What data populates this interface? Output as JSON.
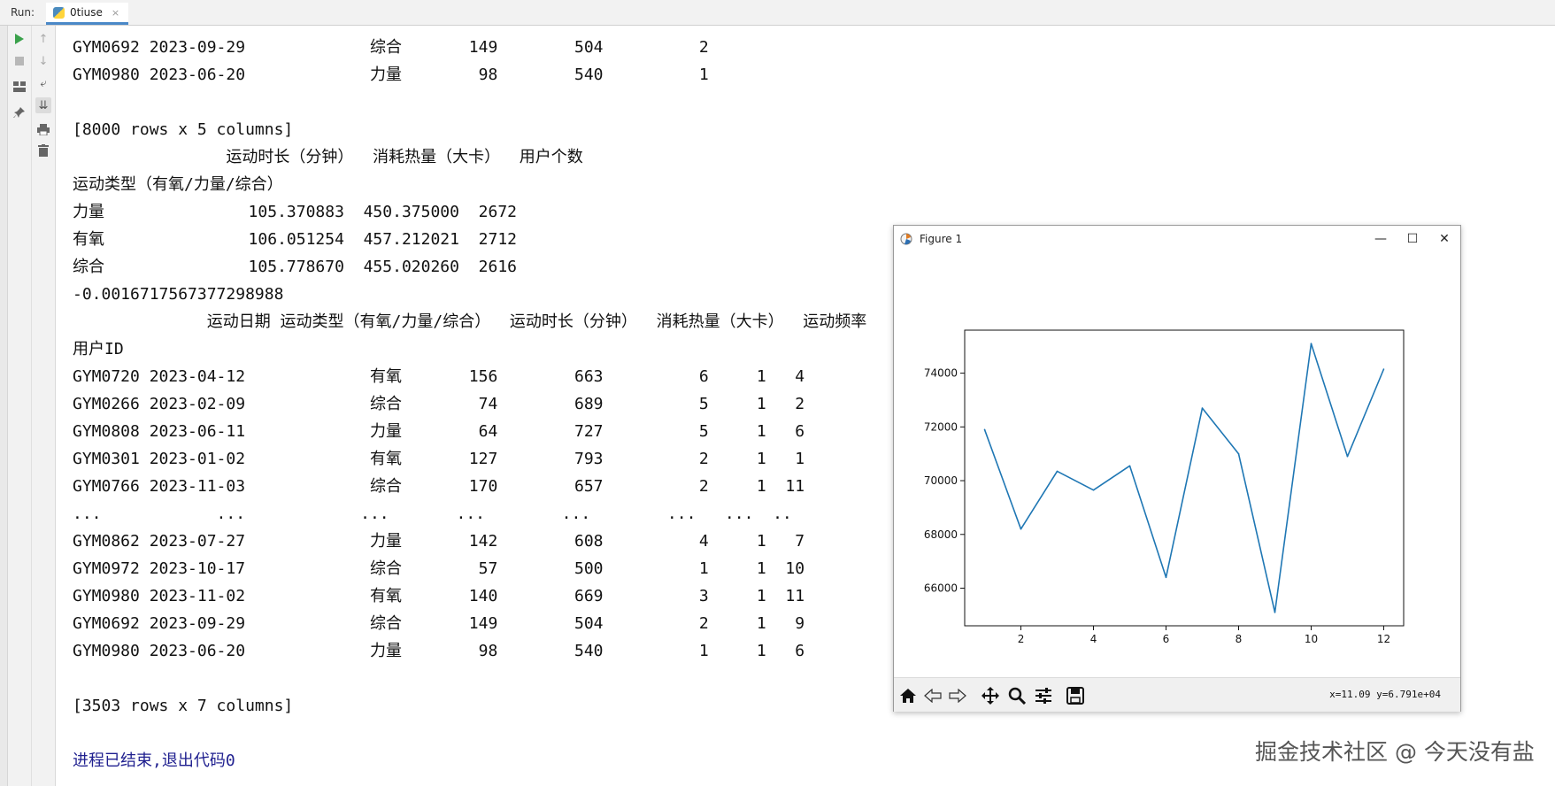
{
  "run_panel": {
    "label": "Run:",
    "tab_title": "0tiuse",
    "tab_close": "×"
  },
  "toolbar": {
    "icons": [
      "run-icon",
      "stop-icon",
      "layout-icon",
      "pin-icon",
      "up-arrow-icon",
      "down-arrow-icon",
      "soft-wrap-icon",
      "scroll-to-end-icon",
      "print-icon",
      "trash-icon"
    ]
  },
  "console": {
    "lines": [
      "GYM0692 2023-09-29             综合       149        504          2",
      "GYM0980 2023-06-20             力量        98        540          1",
      "",
      "[8000 rows x 5 columns]",
      "                运动时长（分钟）  消耗热量（大卡）  用户个数",
      "运动类型（有氧/力量/综合）",
      "力量               105.370883  450.375000  2672",
      "有氧               106.051254  457.212021  2712",
      "综合               105.778670  455.020260  2616",
      "-0.0016717567377298988",
      "              运动日期 运动类型（有氧/力量/综合）  运动时长（分钟）  消耗热量（大卡）  运动频率",
      "用户ID",
      "GYM0720 2023-04-12             有氧       156        663          6     1   4",
      "GYM0266 2023-02-09             综合        74        689          5     1   2",
      "GYM0808 2023-06-11             力量        64        727          5     1   6",
      "GYM0301 2023-01-02             有氧       127        793          2     1   1",
      "GYM0766 2023-11-03             综合       170        657          2     1  11",
      "...            ...            ...       ...        ...        ...   ...  ..",
      "GYM0862 2023-07-27             力量       142        608          4     1   7",
      "GYM0972 2023-10-17             综合        57        500          1     1  10",
      "GYM0980 2023-11-02             有氧       140        669          3     1  11",
      "GYM0692 2023-09-29             综合       149        504          2     1   9",
      "GYM0980 2023-06-20             力量        98        540          1     1   6",
      "",
      "[3503 rows x 7 columns]",
      "",
      "进程已结束,退出代码0"
    ]
  },
  "figure_window": {
    "title": "Figure 1",
    "minimize": "—",
    "maximize": "☐",
    "close": "✕",
    "status_coords": "x=11.09 y=6.791e+04",
    "nav_icons": [
      "home-icon",
      "back-icon",
      "forward-icon",
      "pan-icon",
      "zoom-icon",
      "configure-subplots-icon",
      "save-icon"
    ]
  },
  "chart_data": {
    "type": "line",
    "x": [
      1,
      2,
      3,
      4,
      5,
      6,
      7,
      8,
      9,
      10,
      11,
      12
    ],
    "series": [
      {
        "values": [
          71900,
          68200,
          70350,
          69650,
          70550,
          66400,
          72700,
          71000,
          65100,
          75100,
          70900,
          74150
        ],
        "color": "#1f77b4"
      }
    ],
    "xticks": [
      2,
      4,
      6,
      8,
      10,
      12
    ],
    "yticks": [
      66000,
      68000,
      70000,
      72000,
      74000
    ],
    "xlim": [
      0.45,
      12.55
    ],
    "ylim": [
      64600,
      75600
    ],
    "title": "",
    "xlabel": "",
    "ylabel": "",
    "grid": false
  },
  "watermark": "掘金技术社区 @ 今天没有盐"
}
